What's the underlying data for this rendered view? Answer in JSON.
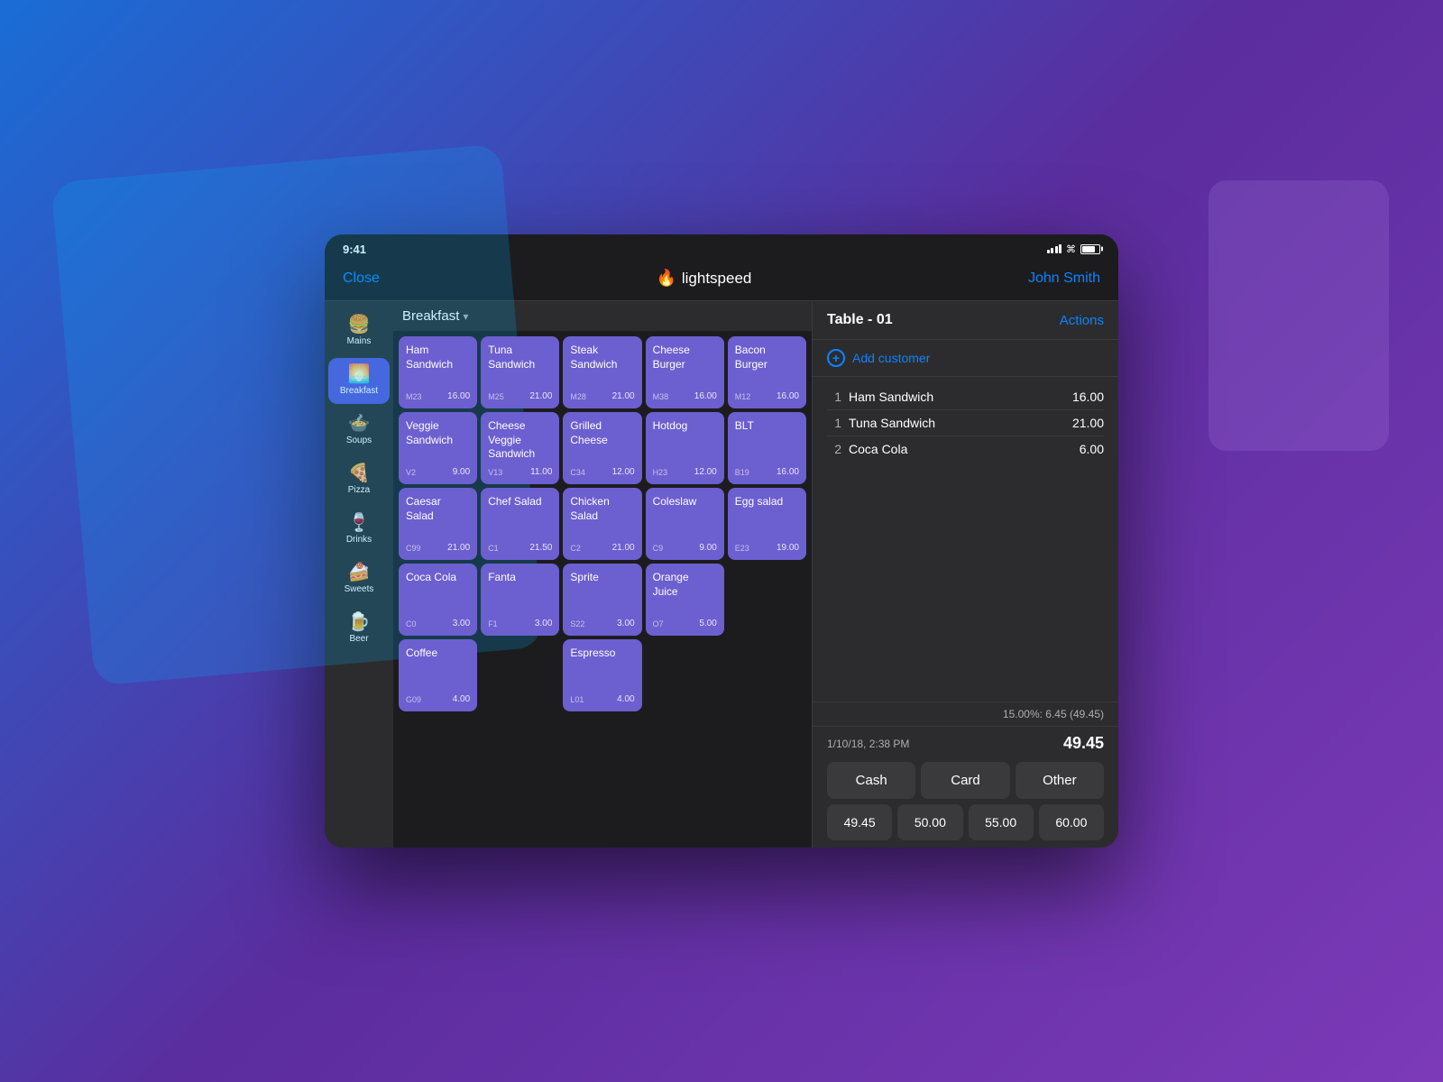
{
  "status_bar": {
    "time": "9:41",
    "signal": "●●●●",
    "wifi": "wifi",
    "battery": "battery"
  },
  "nav": {
    "close_label": "Close",
    "logo_text": "lightspeed",
    "user_name": "John Smith"
  },
  "menu": {
    "category_selected": "Breakfast",
    "dropdown_arrow": "▾",
    "items": [
      {
        "name": "Ham Sandwich",
        "code": "M23",
        "price": "16.00"
      },
      {
        "name": "Tuna Sandwich",
        "code": "M25",
        "price": "21.00"
      },
      {
        "name": "Steak Sandwich",
        "code": "M28",
        "price": "21.00"
      },
      {
        "name": "Cheese Burger",
        "code": "M38",
        "price": "16.00"
      },
      {
        "name": "Bacon Burger",
        "code": "M12",
        "price": "16.00"
      },
      {
        "name": "Veggie Sandwich",
        "code": "V2",
        "price": "9.00"
      },
      {
        "name": "Cheese Veggie Sandwich",
        "code": "V13",
        "price": "11.00"
      },
      {
        "name": "Grilled Cheese",
        "code": "C34",
        "price": "12.00"
      },
      {
        "name": "Hotdog",
        "code": "H23",
        "price": "12.00"
      },
      {
        "name": "BLT",
        "code": "B19",
        "price": "16.00"
      },
      {
        "name": "Caesar Salad",
        "code": "C99",
        "price": "21.00"
      },
      {
        "name": "Chef Salad",
        "code": "C1",
        "price": "21.50"
      },
      {
        "name": "Chicken Salad",
        "code": "C2",
        "price": "21.00"
      },
      {
        "name": "Coleslaw",
        "code": "C9",
        "price": "9.00"
      },
      {
        "name": "Egg salad",
        "code": "E23",
        "price": "19.00"
      },
      {
        "name": "Coca Cola",
        "code": "C0",
        "price": "3.00"
      },
      {
        "name": "Fanta",
        "code": "F1",
        "price": "3.00"
      },
      {
        "name": "Sprite",
        "code": "S22",
        "price": "3.00"
      },
      {
        "name": "Orange Juice",
        "code": "O7",
        "price": "5.00"
      },
      {
        "name": "",
        "code": "",
        "price": ""
      },
      {
        "name": "Coffee",
        "code": "G09",
        "price": "4.00"
      },
      {
        "name": "",
        "code": "",
        "price": ""
      },
      {
        "name": "Espresso",
        "code": "L01",
        "price": "4.00"
      },
      {
        "name": "",
        "code": "",
        "price": ""
      },
      {
        "name": "",
        "code": "",
        "price": ""
      }
    ]
  },
  "sidebar": {
    "items": [
      {
        "icon": "🍔",
        "label": "Mains",
        "active": false
      },
      {
        "icon": "🌅",
        "label": "Breakfast",
        "active": true
      },
      {
        "icon": "🍲",
        "label": "Soups",
        "active": false
      },
      {
        "icon": "🍕",
        "label": "Pizza",
        "active": false
      },
      {
        "icon": "🍷",
        "label": "Drinks",
        "active": false
      },
      {
        "icon": "🍰",
        "label": "Sweets",
        "active": false
      },
      {
        "icon": "🍺",
        "label": "Beer",
        "active": false
      }
    ]
  },
  "order": {
    "table_title": "Table - 01",
    "actions_label": "Actions",
    "add_customer_label": "Add customer",
    "items": [
      {
        "qty": "1",
        "name": "Ham Sandwich",
        "price": "16.00"
      },
      {
        "qty": "1",
        "name": "Tuna Sandwich",
        "price": "21.00"
      },
      {
        "qty": "2",
        "name": "Coca Cola",
        "price": "6.00"
      }
    ],
    "tax_line": "15.00%: 6.45 (49.45)",
    "date": "1/10/18, 2:38 PM",
    "total": "49.45",
    "payment_buttons": [
      {
        "label": "Cash"
      },
      {
        "label": "Card"
      },
      {
        "label": "Other"
      }
    ],
    "amount_buttons": [
      {
        "label": "49.45"
      },
      {
        "label": "50.00"
      },
      {
        "label": "55.00"
      },
      {
        "label": "60.00"
      }
    ]
  }
}
